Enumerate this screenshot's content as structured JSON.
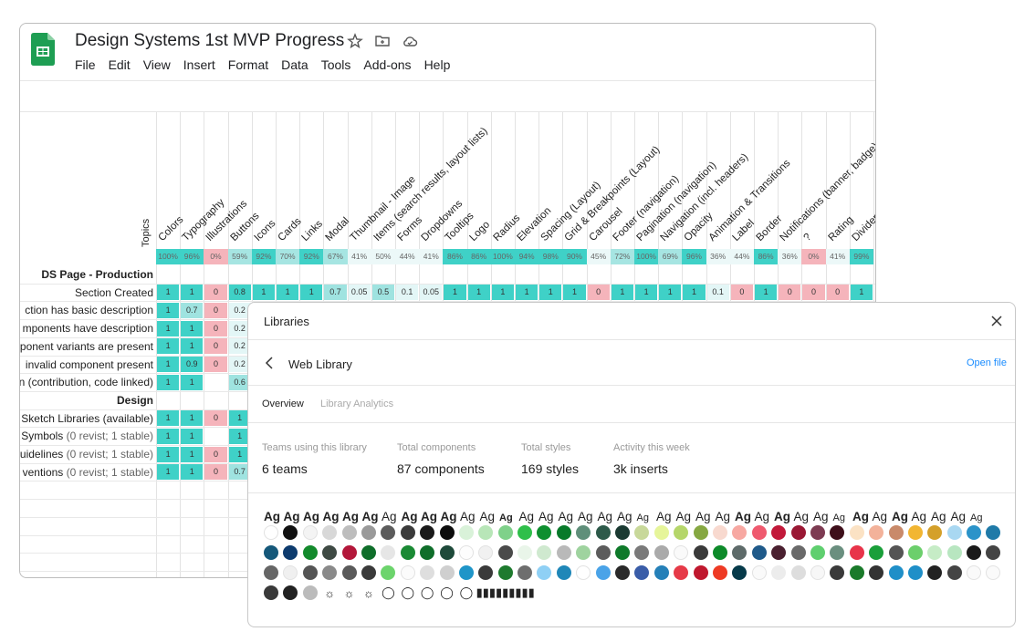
{
  "sheet": {
    "title": "Design Systems 1st MVP Progress",
    "menu": [
      "File",
      "Edit",
      "View",
      "Insert",
      "Format",
      "Data",
      "Tools",
      "Add-ons",
      "Help"
    ],
    "topics_label": "Topics",
    "columns": [
      "Colors",
      "Typography",
      "Illustrations",
      "Buttons",
      "Icons",
      "Cards",
      "Links",
      "Modal",
      "Thumbnail - Image",
      "Items (search results, layout lists)",
      "Forms",
      "Dropdowns",
      "Tooltips",
      "Logo",
      "Radius",
      "Elevation",
      "Spacing (Layout)",
      "Grid & Breakpoints (Layout)",
      "Carousel",
      "Footer (navigation)",
      "Pagination (navigation)",
      "Navigation (incl. headers)",
      "Opacity",
      "Animation & Transitions",
      "Label",
      "Border",
      "Notifications (banner, badge)",
      "?",
      "Rating",
      "Divider"
    ],
    "percentages": [
      "100%",
      "96%",
      "0%",
      "59%",
      "92%",
      "70%",
      "92%",
      "67%",
      "41%",
      "50%",
      "44%",
      "41%",
      "86%",
      "86%",
      "100%",
      "94%",
      "98%",
      "90%",
      "45%",
      "72%",
      "100%",
      "69%",
      "96%",
      "36%",
      "44%",
      "86%",
      "36%",
      "0%",
      "41%",
      "99%"
    ],
    "rows": [
      {
        "label": "DS Page - Production",
        "type": "section"
      },
      {
        "label": "Section Created",
        "type": "row",
        "values": [
          "1",
          "1",
          "0",
          "0.8",
          "1",
          "1",
          "1",
          "0.7",
          "0.05",
          "0.5",
          "0.1",
          "0.05",
          "1",
          "1",
          "1",
          "1",
          "1",
          "1",
          "0",
          "1",
          "1",
          "1",
          "1",
          "0.1",
          "0",
          "1",
          "0",
          "0",
          "0",
          "1"
        ]
      },
      {
        "label": "ction has basic description",
        "type": "row",
        "values": [
          "1",
          "0.7",
          "0",
          "0.2"
        ]
      },
      {
        "label": "mponents have description",
        "type": "row",
        "values": [
          "1",
          "1",
          "0",
          "0.2"
        ]
      },
      {
        "label": "ponent variants are present",
        "type": "row",
        "values": [
          "1",
          "1",
          "0",
          "0.2"
        ]
      },
      {
        "label": "invalid component present",
        "type": "row",
        "values": [
          "1",
          "0.9",
          "0",
          "0.2"
        ]
      },
      {
        "label": "n (contribution, code linked)",
        "type": "row",
        "values": [
          "1",
          "1",
          "",
          "0.6"
        ]
      },
      {
        "label": "Design",
        "type": "section"
      },
      {
        "label": "Sketch Libraries (available)",
        "muted": "",
        "type": "row",
        "values": [
          "1",
          "1",
          "0",
          "1"
        ]
      },
      {
        "label": "Symbols",
        "muted": "(0 revist; 1 stable)",
        "type": "row",
        "values": [
          "1",
          "1",
          "",
          "1"
        ]
      },
      {
        "label": "uidelines",
        "muted": "(0 revist; 1 stable)",
        "type": "row",
        "values": [
          "1",
          "1",
          "0",
          "1"
        ]
      },
      {
        "label": "ventions",
        "muted": "(0 revist; 1 stable)",
        "type": "row",
        "values": [
          "1",
          "1",
          "0",
          "0.7"
        ]
      }
    ]
  },
  "panel": {
    "title": "Libraries",
    "library_name": "Web Library",
    "open_file": "Open file",
    "tabs": [
      "Overview",
      "Library Analytics"
    ],
    "stats": [
      {
        "label": "Teams using this library",
        "value": "6 teams"
      },
      {
        "label": "Total components",
        "value": "87 components"
      },
      {
        "label": "Total styles",
        "value": "169 styles"
      },
      {
        "label": "Activity this week",
        "value": "3k inserts"
      }
    ],
    "type_styles": [
      "Ag",
      "Ag",
      "Ag",
      "Ag",
      "Ag",
      "Ag",
      "Ag",
      "Ag",
      "Ag",
      "Ag",
      "Ag",
      "Ag",
      "Ag",
      "Ag",
      "Ag",
      "Ag",
      "Ag",
      "Ag",
      "Ag",
      "Ag",
      "Ag",
      "Ag",
      "Ag",
      "Ag",
      "Ag",
      "Ag",
      "Ag",
      "Ag",
      "Ag",
      "Ag",
      "Ag",
      "Ag",
      "Ag",
      "Ag",
      "Ag",
      "Ag",
      "Ag"
    ],
    "color_styles": [
      "#ffffff",
      "#111111",
      "#f4f4f4",
      "#d8d8d8",
      "#bdbdbd",
      "#9a9a9a",
      "#5c5c5c",
      "#3b3b3b",
      "#1a1a1a",
      "#0d0d0d",
      "#d9f2d9",
      "#b8e6b8",
      "#7fd18a",
      "#2fbf4a",
      "#0e8f2f",
      "#087a2a",
      "#5f8f7a",
      "#2d5a4a",
      "#1b3a32",
      "#c8d89a",
      "#e6f59a",
      "#b5d66a",
      "#86a842",
      "#f8d9cf",
      "#f7a8a2",
      "#ef5a6f",
      "#c2193a",
      "#9a1834",
      "#7d3b52",
      "#3e0f1a",
      "#fbe2c4",
      "#f3b29a",
      "#c98a6a",
      "#f2b632",
      "#d4a02a",
      "#a9d8f2",
      "#2b93c9",
      "#1f7aa8",
      "#15587a",
      "#0d3b6e",
      "#138a2c",
      "#3f4a44",
      "#b3173a",
      "#0f6e2a",
      "#e6e6e6",
      "#1a8a34",
      "#0f6e2a",
      "#1e4a3a",
      "#fdfdfd",
      "#f1f1f1",
      "#4a4a4a",
      "#e9f5e9",
      "#cfe9cf",
      "#b9b9b9",
      "#9fd39f",
      "#5c5c5c",
      "#0f7a2a",
      "#7a7a7a",
      "#aaaaaa",
      "#fafafa",
      "#3a3a3a",
      "#0d8a2a",
      "#5e6b6a",
      "#1f5a8a",
      "#4a2030",
      "#6a6a6a",
      "#5fcf6f",
      "#6a8f7f",
      "#e8344a",
      "#1a9f3a",
      "#555555",
      "#6ccf6c",
      "#c6ecc6",
      "#b8e6c0",
      "#1a1a1a",
      "#444444",
      "#666666",
      "#f0f0f0",
      "#555555",
      "#8a8a8a",
      "#5a5a5a",
      "#3a3a3a",
      "#6cd46c",
      "#fbfbfb",
      "#dedede",
      "#cfcfcf",
      "#1f95c8",
      "#3a3a3a",
      "#1e7a2e",
      "#6e6e6e",
      "#8fd0f5",
      "#1f87b8",
      "#ffffff",
      "#4aa3e8",
      "#2a2a2a",
      "#3a5da8",
      "#2580b8",
      "#e63a48",
      "#c0182e",
      "#ee3a24",
      "#063a4a",
      "#fafafa",
      "#ececec",
      "#dddddd",
      "#f7f7f7",
      "#3a3a3a",
      "#1a7a2a",
      "#333333",
      "#1f8fc8",
      "#1f8fc8",
      "#222222",
      "#444444",
      "#fafafa",
      "#fafafa",
      "#3a3a3a",
      "#222222",
      "#bbbbbb"
    ],
    "glyphs": [
      "☼",
      "☼",
      "☼",
      "◯",
      "◯",
      "◯",
      "◯",
      "◯",
      "▮▮▮",
      "▮▮▮",
      "▮▮▮"
    ]
  }
}
